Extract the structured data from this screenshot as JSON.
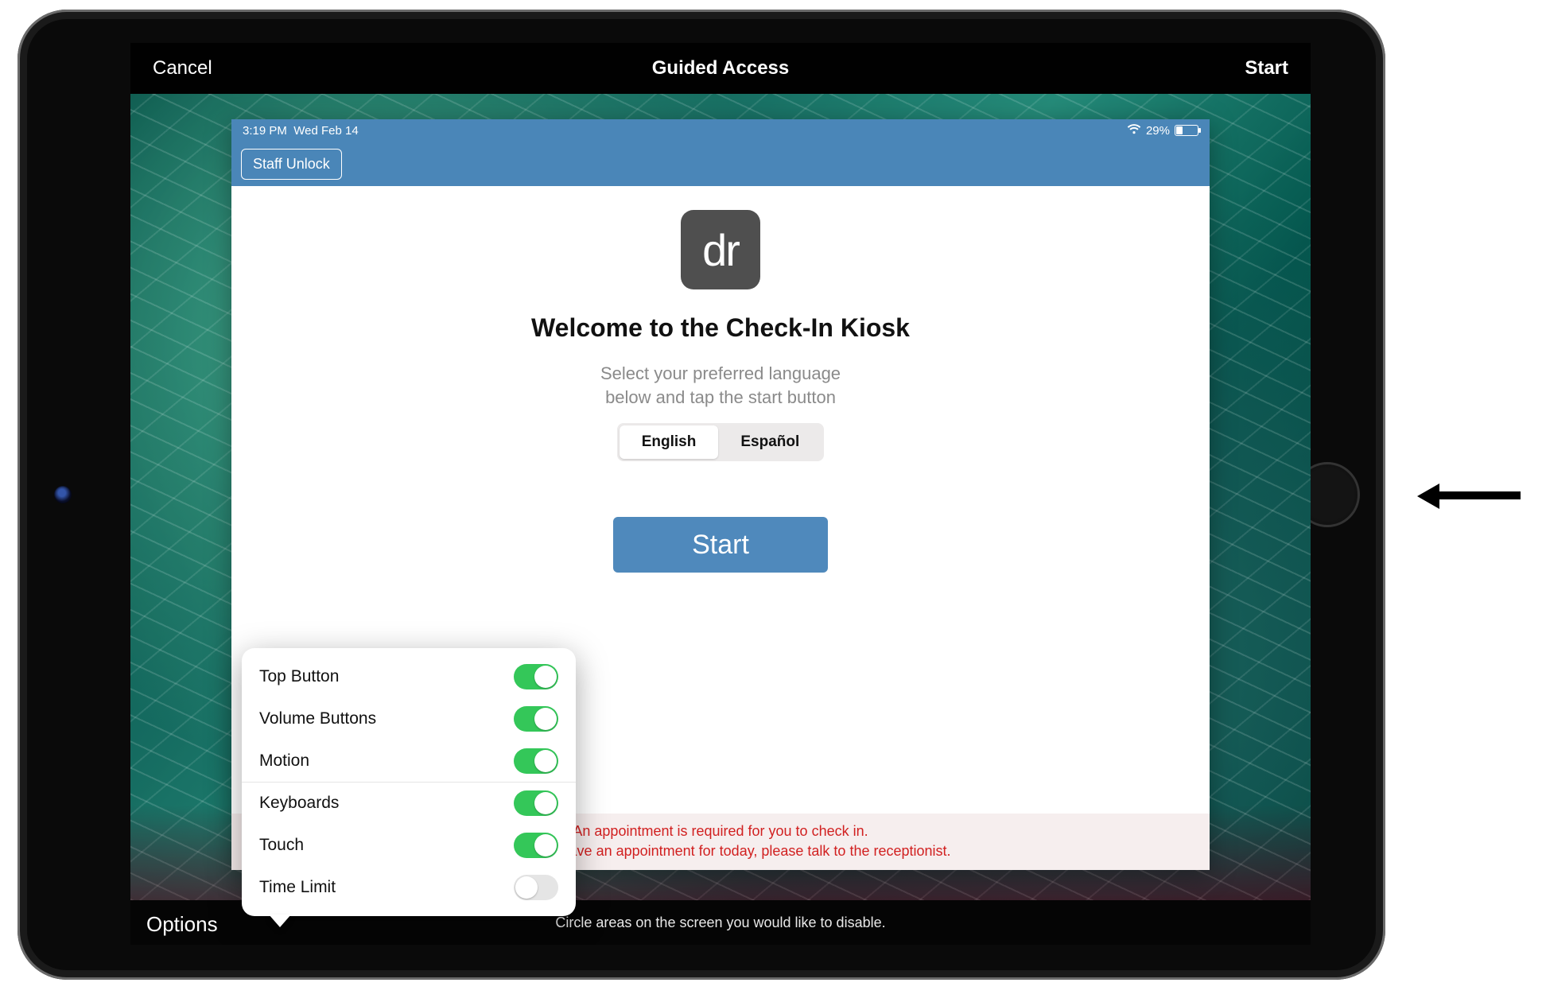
{
  "guided_access": {
    "cancel": "Cancel",
    "title": "Guided Access",
    "start": "Start",
    "instruction": "Circle areas on the screen you would like to disable.",
    "options_label": "Options"
  },
  "status_bar": {
    "time": "3:19 PM",
    "date": "Wed Feb 14",
    "battery_percent": "29%"
  },
  "app": {
    "staff_unlock": "Staff Unlock",
    "logo_text": "dr",
    "welcome_title": "Welcome to the Check-In Kiosk",
    "welcome_sub_line1": "Select your preferred language",
    "welcome_sub_line2": "below and tap the start button",
    "languages": {
      "english": "English",
      "spanish": "Español"
    },
    "start_button": "Start",
    "error_line1": "An appointment is required for you to check in.",
    "error_line2": "you do not have an appointment for today, please talk to the receptionist."
  },
  "options": [
    {
      "label": "Top Button",
      "on": true
    },
    {
      "label": "Volume Buttons",
      "on": true
    },
    {
      "label": "Motion",
      "on": true
    },
    {
      "label": "Keyboards",
      "on": true
    },
    {
      "label": "Touch",
      "on": true
    },
    {
      "label": "Time Limit",
      "on": false
    }
  ]
}
